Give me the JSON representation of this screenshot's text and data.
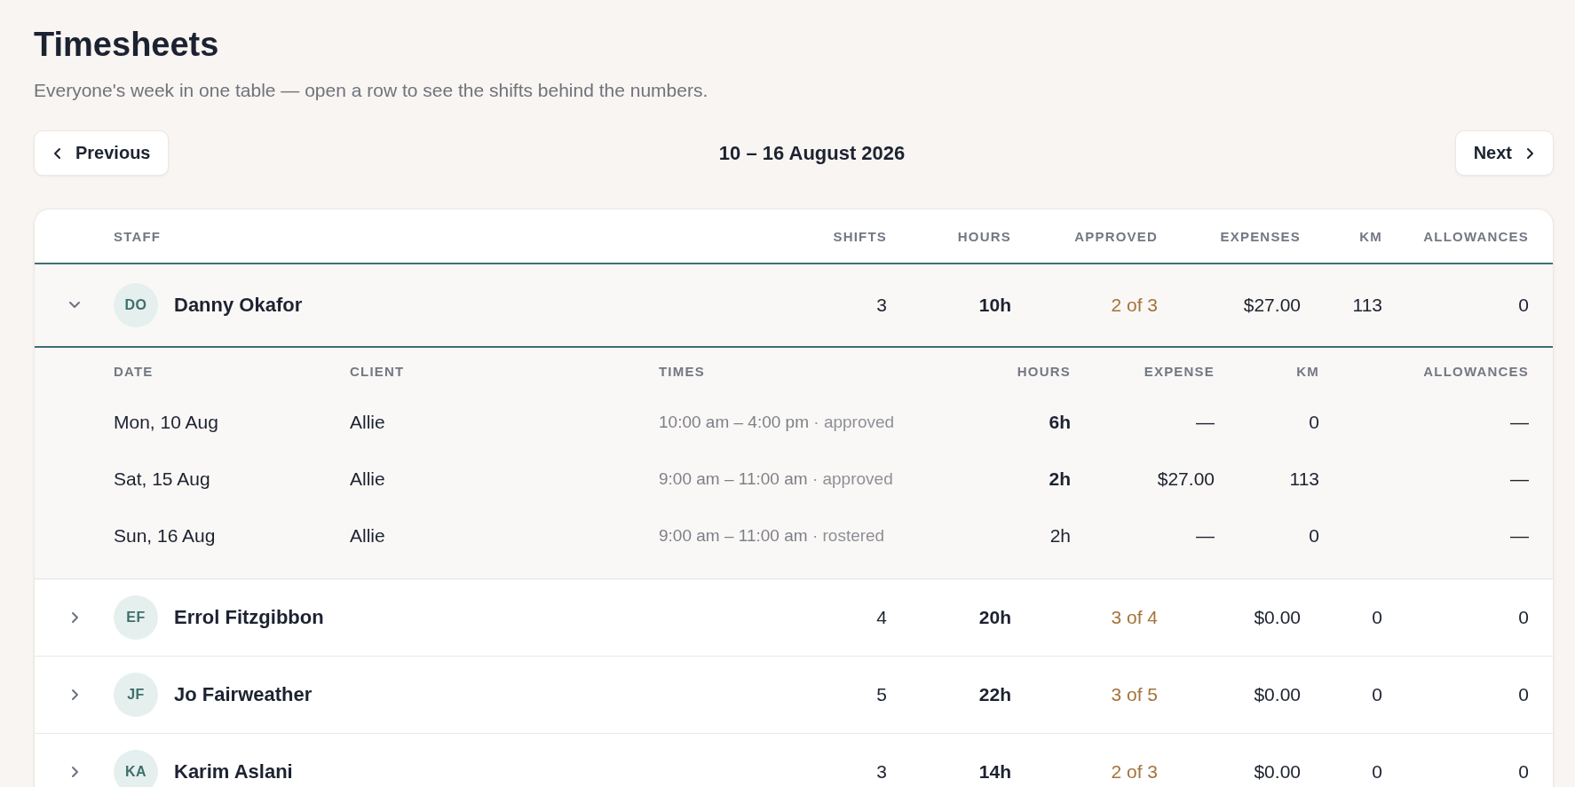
{
  "title": "Timesheets",
  "subtitle": "Everyone's week in one table — open a row to see the shifts behind the numbers.",
  "nav": {
    "previous": "Previous",
    "period": "10 – 16 August 2026",
    "next": "Next"
  },
  "table": {
    "columns": [
      "STAFF",
      "SHIFTS",
      "HOURS",
      "APPROVED",
      "EXPENSES",
      "KM",
      "ALLOWANCES"
    ],
    "detail_columns": [
      "DATE",
      "CLIENT",
      "TIMES",
      "HOURS",
      "EXPENSE",
      "KM",
      "ALLOWANCES"
    ],
    "rows": [
      {
        "initials": "DO",
        "name": "Danny Okafor",
        "expanded": true,
        "shift_count": "3",
        "hours": "10h",
        "approved": "2 of 3",
        "expenses": "$27.00",
        "km": "113",
        "allowances": "0",
        "shifts": [
          {
            "date": "Mon, 10 Aug",
            "client": "Allie",
            "times": "10:00 am – 4:00 pm",
            "status": "· approved",
            "approved": true,
            "hours": "6h",
            "expense": "—",
            "km": "0",
            "allowances": "—"
          },
          {
            "date": "Sat, 15 Aug",
            "client": "Allie",
            "times": "9:00 am – 11:00 am",
            "status": "· approved",
            "approved": true,
            "hours": "2h",
            "expense": "$27.00",
            "km": "113",
            "allowances": "—"
          },
          {
            "date": "Sun, 16 Aug",
            "client": "Allie",
            "times": "9:00 am – 11:00 am",
            "status": "· rostered",
            "approved": false,
            "hours": "2h",
            "expense": "—",
            "km": "0",
            "allowances": "—"
          }
        ]
      },
      {
        "initials": "EF",
        "name": "Errol Fitzgibbon",
        "expanded": false,
        "shift_count": "4",
        "hours": "20h",
        "approved": "3 of 4",
        "expenses": "$0.00",
        "km": "0",
        "allowances": "0"
      },
      {
        "initials": "JF",
        "name": "Jo Fairweather",
        "expanded": false,
        "shift_count": "5",
        "hours": "22h",
        "approved": "3 of 5",
        "expenses": "$0.00",
        "km": "0",
        "allowances": "0"
      },
      {
        "initials": "KA",
        "name": "Karim Aslani",
        "expanded": false,
        "shift_count": "3",
        "hours": "14h",
        "approved": "2 of 3",
        "expenses": "$0.00",
        "km": "0",
        "allowances": "0"
      }
    ]
  }
}
